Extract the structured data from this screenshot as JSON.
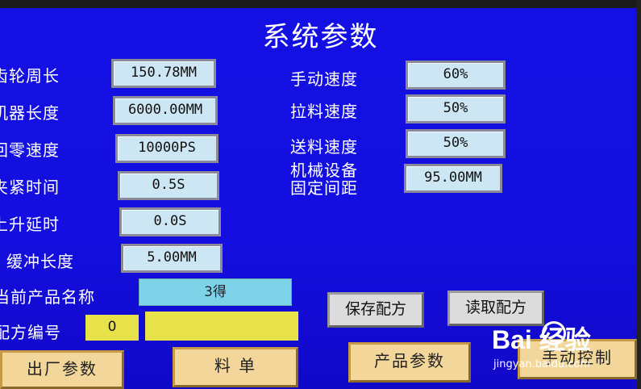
{
  "title": "系统参数",
  "left_params": [
    {
      "label": "齿轮周长",
      "value": "150.78MM"
    },
    {
      "label": "机器长度",
      "value": "6000.00MM"
    },
    {
      "label": "回零速度",
      "value": "10000PS"
    },
    {
      "label": "夹紧时间",
      "value": "0.5S"
    },
    {
      "label": "上升延时",
      "value": "0.0S"
    },
    {
      "label": "缓冲长度",
      "value": "5.00MM"
    }
  ],
  "right_params": [
    {
      "label": "手动速度",
      "value": "60%"
    },
    {
      "label": "拉料速度",
      "value": "50%"
    },
    {
      "label": "送料速度",
      "value": "50%"
    },
    {
      "label_line1": "机械设备",
      "label_line2": "固定间距",
      "value": "95.00MM"
    }
  ],
  "product_name": {
    "label": "当前产品名称",
    "value": "3得"
  },
  "recipe": {
    "label": "配方编号",
    "number": "0",
    "name": ""
  },
  "buttons": {
    "save_recipe": "保存配方",
    "read_recipe": "读取配方",
    "factory_params": "出厂参数",
    "material_list": "料 单",
    "product_params": "产品参数",
    "manual_control": "手动控制"
  },
  "watermark": {
    "main": "Bai  经验",
    "sub": "jingyan.baidu.com"
  }
}
